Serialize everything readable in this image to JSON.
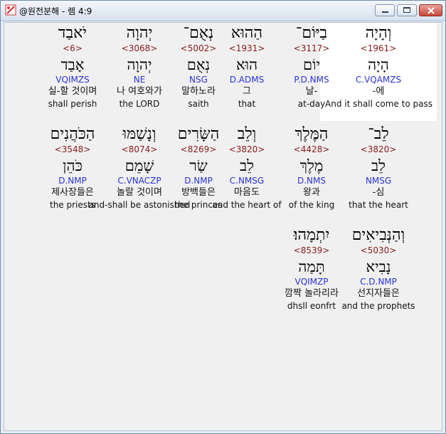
{
  "window": {
    "title": "@원전분해 - 렘 4:9",
    "icons": {
      "app": "bible-app-icon",
      "minimize": "minimize-icon",
      "maximize": "maximize-icon",
      "close": "close-icon"
    },
    "colors": {
      "strong": "#8b1a1a",
      "parse": "#2a33d6",
      "highlight": "#ffffff"
    }
  },
  "rows": [
    {
      "words": [
        {
          "heb": "וְהָיָה",
          "strong": "<1961>",
          "lemma": "הָיָה",
          "parse": "C.VQAMZS",
          "kor": "-에",
          "eng": "And it shall come to pass",
          "highlighted": true
        },
        {
          "heb": "בַיּוֹם־",
          "strong": "<3117>",
          "lemma": "יוֹם",
          "parse": "P.D.NMS",
          "kor": "날-",
          "eng": "at-day"
        },
        {
          "heb": "הַהוּא",
          "strong": "<1931>",
          "lemma": "הוּא",
          "parse": "D.ADMS",
          "kor": "그",
          "eng": "that"
        },
        {
          "heb": "נְאֻם־",
          "strong": "<5002>",
          "lemma": "נְאֻם",
          "parse": "NSG",
          "kor": "말하노라",
          "eng": "saith"
        },
        {
          "heb": "יְהוָה",
          "strong": "<3068>",
          "lemma": "יְהוָה",
          "parse": "NE",
          "kor": "나 여호와가",
          "eng": "the LORD"
        },
        {
          "heb": "יֹאבַד",
          "strong": "<6>",
          "lemma": "אָבַד",
          "parse": "VQIMZS",
          "kor": "실-할 것이며",
          "eng": "shall perish"
        }
      ]
    },
    {
      "words": [
        {
          "heb": "לֵב־",
          "strong": "<3820>",
          "lemma": "לֵב",
          "parse": "NMSG",
          "kor": "-심",
          "eng": "that the heart"
        },
        {
          "heb": "הַמֶּלֶךְ",
          "strong": "<4428>",
          "lemma": "מֶלֶךְ",
          "parse": "D.NMS",
          "kor": "왕과",
          "eng": "of the king"
        },
        {
          "heb": "וְלֵב",
          "strong": "<3820>",
          "lemma": "לֵב",
          "parse": "C.NMSG",
          "kor": "마음도",
          "eng": "and the heart of"
        },
        {
          "heb": "הַשָּׂרִים",
          "strong": "<8269>",
          "lemma": "שַׂר",
          "parse": "D.NMP",
          "kor": "방백들은",
          "eng": "the princes"
        },
        {
          "heb": "וְנָשַׁמּוּ",
          "strong": "<8074>",
          "lemma": "שָׁמֵם",
          "parse": "C.VNACZP",
          "kor": "놀랄 것이며",
          "eng": "and-shall be astonished"
        },
        {
          "heb": "הַכֹּהֲנִים",
          "strong": "<3548>",
          "lemma": "כֹּהֵן",
          "parse": "D.NMP",
          "kor": "제사장들은",
          "eng": "the priests"
        }
      ]
    },
    {
      "words": [
        {
          "heb": "וְהַנְּבִיאִים",
          "strong": "<5030>",
          "lemma": "נָבִיא",
          "parse": "C.D.NMP",
          "kor": "선지자들은",
          "eng": "and the prophets"
        },
        {
          "heb": "יִתְמָהוּ׃",
          "strong": "<8539>",
          "lemma": "תָּמַה",
          "parse": "VQIMZP",
          "kor": "깜짝 놀라리라",
          "eng": "dhsll eonfrt"
        }
      ]
    }
  ]
}
